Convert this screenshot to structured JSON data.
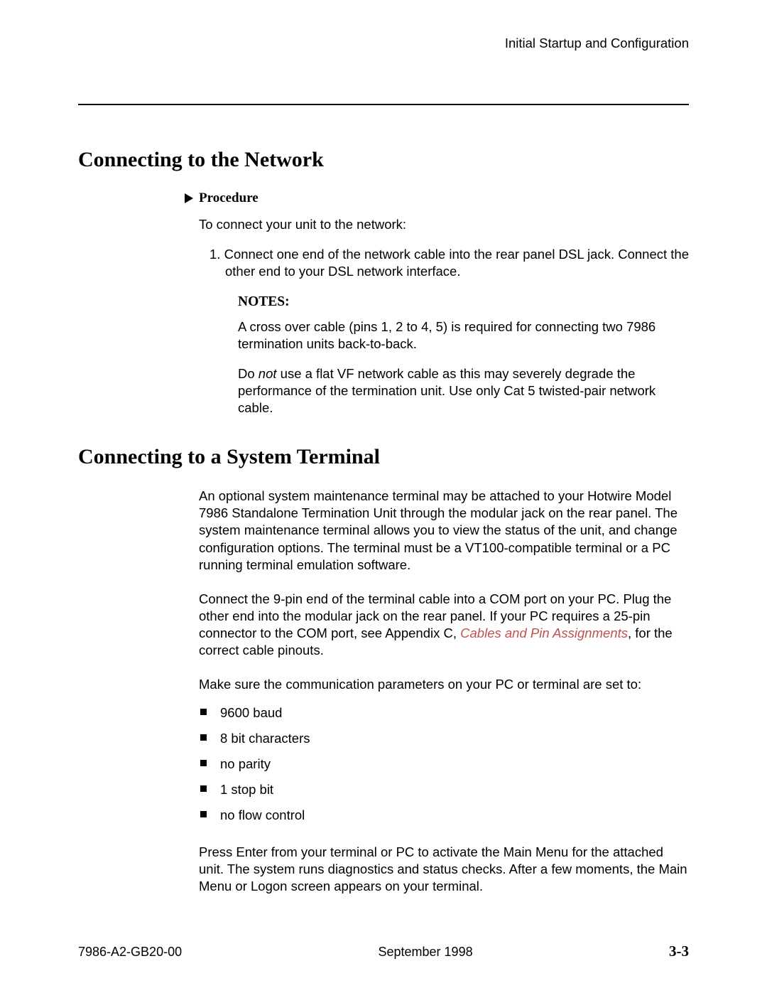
{
  "header": {
    "running": "Initial Startup and Configuration"
  },
  "s1": {
    "title": "Connecting to the Network",
    "procedure_label": "Procedure",
    "intro": "To connect your unit to the network:",
    "step1_num": "1.",
    "step1_text": "Connect one end of the network cable into the rear panel DSL jack. Connect the other end to your DSL network interface.",
    "notes_label": "NOTES:",
    "note1": "A cross over cable (pins 1, 2 to 4, 5) is required for connecting two 7986 termination units back-to-back.",
    "note2_a": "Do ",
    "note2_not": "not",
    "note2_b": " use a flat VF network cable as this may severely degrade the performance of the termination unit. Use only Cat 5 twisted-pair network cable."
  },
  "s2": {
    "title": "Connecting to a System Terminal",
    "p1": "An optional system maintenance terminal may be attached to your Hotwire Model 7986 Standalone Termination Unit through the modular jack on the rear panel. The system maintenance terminal allows you to view the status of the unit, and change configuration options. The terminal must be a VT100-compatible terminal or a PC running terminal emulation software.",
    "p2_a": "Connect the 9-pin end of the terminal cable into a COM port on your PC. Plug the other end into the modular jack on the rear panel. If your PC requires a 25-pin connector to the COM port, see Appendix C, ",
    "p2_link": "Cables and Pin Assignments",
    "p2_b": ", for the correct cable pinouts.",
    "p3": "Make sure the communication parameters on your PC or terminal are set to:",
    "bullets": [
      "9600 baud",
      "8 bit characters",
      "no parity",
      "1 stop bit",
      "no flow control"
    ],
    "p4": "Press Enter from your terminal or PC to activate the Main Menu for the attached unit. The system runs diagnostics and status checks. After a few moments, the Main Menu or Logon screen appears on your terminal."
  },
  "footer": {
    "left": "7986-A2-GB20-00",
    "center": "September 1998",
    "right": "3-3"
  }
}
